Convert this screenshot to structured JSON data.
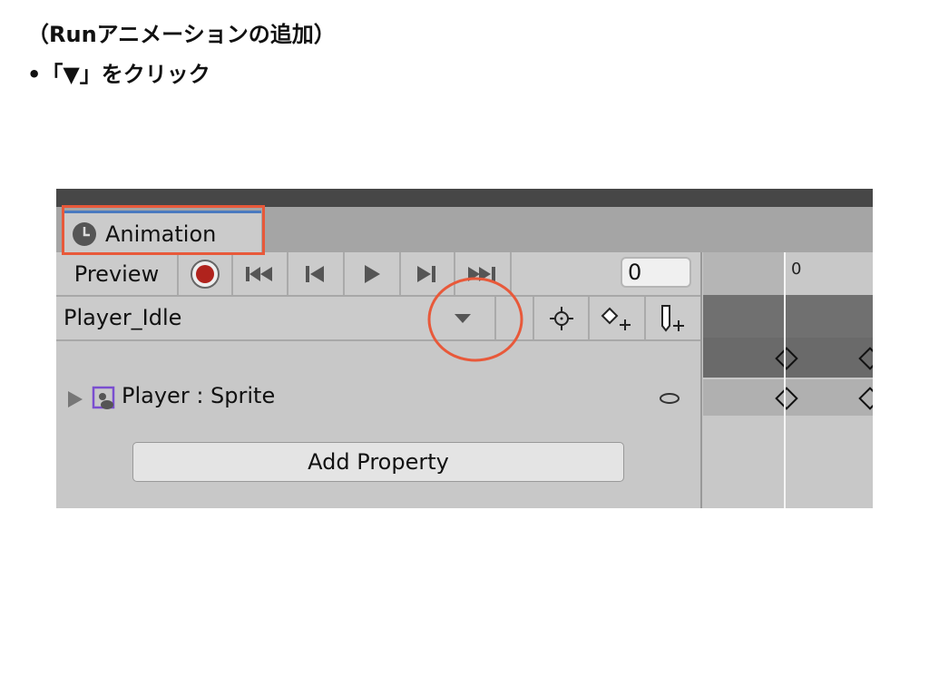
{
  "slide": {
    "heading": "（Runアニメーションの追加）",
    "bullet": "•「▼」をクリック"
  },
  "window": {
    "tab_label": "Animation",
    "preview_label": "Preview",
    "frame_value": "0",
    "ruler_label": "0",
    "clip_name": "Player_Idle",
    "property_label": "Player : Sprite",
    "add_property_label": "Add Property"
  },
  "colors": {
    "highlight": "#e8593a",
    "record": "#b0231d",
    "tab_accent": "#4a7ac0"
  }
}
